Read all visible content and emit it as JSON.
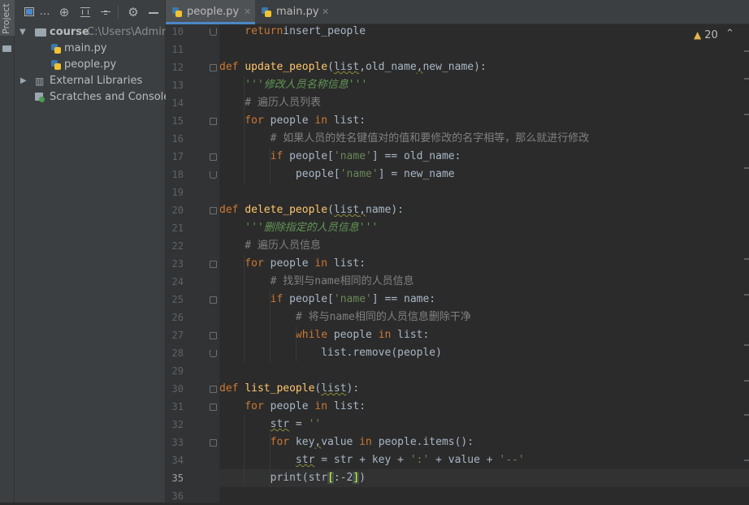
{
  "sidebar_strip": {
    "label": "Project"
  },
  "project_toolbar": {
    "icons": [
      "layout-icon",
      "ellipsis-icon",
      "locate-icon",
      "expand-all-icon",
      "collapse-all-icon",
      "gear-icon",
      "minimize-icon"
    ],
    "ellipsis": "…"
  },
  "project_tree": {
    "root": {
      "name": "course",
      "path": "C:\\Users\\Adminis"
    },
    "files": [
      {
        "name": "main.py"
      },
      {
        "name": "people.py"
      }
    ],
    "external_libraries": "External Libraries",
    "scratches": "Scratches and Consoles"
  },
  "editor_tabs": [
    {
      "name": "people.py",
      "active": true
    },
    {
      "name": "main.py",
      "active": false
    }
  ],
  "inspection": {
    "warning_count": "20",
    "icon": "warning-triangle-icon"
  },
  "colors": {
    "keyword": "#cc7832",
    "function": "#ffc66d",
    "string": "#6a8759",
    "comment": "#808080",
    "background": "#2b2b2b"
  },
  "code_lines": [
    {
      "ln": "10",
      "tokens": [
        [
          "kw",
          "    return"
        ],
        [
          "",
          "insert_people"
        ]
      ]
    },
    {
      "ln": "11",
      "tokens": []
    },
    {
      "ln": "12",
      "tokens": [
        [
          "kw",
          "def "
        ],
        [
          "fn",
          "update_people"
        ],
        [
          "",
          "("
        ],
        [
          "sq",
          "list"
        ],
        [
          "",
          ","
        ],
        [
          "",
          "old_name"
        ],
        [
          "sq",
          ","
        ],
        [
          "",
          "new_name):"
        ]
      ]
    },
    {
      "ln": "13",
      "tokens": [
        [
          "doc",
          "    '''修改人员名称信息'''"
        ]
      ]
    },
    {
      "ln": "14",
      "tokens": [
        [
          "cmt",
          "    # 遍历人员列表"
        ]
      ]
    },
    {
      "ln": "15",
      "tokens": [
        [
          "kw",
          "    for "
        ],
        [
          "",
          "people "
        ],
        [
          "kw",
          "in "
        ],
        [
          "",
          "list:"
        ]
      ]
    },
    {
      "ln": "16",
      "tokens": [
        [
          "cmt",
          "        # 如果人员的姓名键值对的值和要修改的名字相等，那么就进行修改"
        ]
      ]
    },
    {
      "ln": "17",
      "tokens": [
        [
          "kw",
          "        if "
        ],
        [
          "",
          "people["
        ],
        [
          "str",
          "'name'"
        ],
        [
          "",
          "] == old_name:"
        ]
      ]
    },
    {
      "ln": "18",
      "tokens": [
        [
          "",
          "            people["
        ],
        [
          "str",
          "'name'"
        ],
        [
          "",
          "] = new_name"
        ]
      ]
    },
    {
      "ln": "19",
      "tokens": []
    },
    {
      "ln": "20",
      "tokens": [
        [
          "kw",
          "def "
        ],
        [
          "fn",
          "delete_people"
        ],
        [
          "",
          "("
        ],
        [
          "sq",
          "list"
        ],
        [
          "sq",
          ","
        ],
        [
          "",
          "name):"
        ]
      ]
    },
    {
      "ln": "21",
      "tokens": [
        [
          "doc",
          "    '''删除指定的人员信息'''"
        ]
      ]
    },
    {
      "ln": "22",
      "tokens": [
        [
          "cmt",
          "    # 遍历人员信息"
        ]
      ]
    },
    {
      "ln": "23",
      "tokens": [
        [
          "kw",
          "    for "
        ],
        [
          "",
          "people "
        ],
        [
          "kw",
          "in "
        ],
        [
          "",
          "list:"
        ]
      ]
    },
    {
      "ln": "24",
      "tokens": [
        [
          "cmt",
          "        # 找到与name相同的人员信息"
        ]
      ]
    },
    {
      "ln": "25",
      "tokens": [
        [
          "kw",
          "        if "
        ],
        [
          "",
          "people["
        ],
        [
          "str",
          "'name'"
        ],
        [
          "",
          "] == name:"
        ]
      ]
    },
    {
      "ln": "26",
      "tokens": [
        [
          "cmt",
          "            # 将与name相同的人员信息删除干净"
        ]
      ]
    },
    {
      "ln": "27",
      "tokens": [
        [
          "kw",
          "            while "
        ],
        [
          "",
          "people "
        ],
        [
          "kw",
          "in "
        ],
        [
          "",
          "list:"
        ]
      ]
    },
    {
      "ln": "28",
      "tokens": [
        [
          "",
          "                list.remove(people)"
        ]
      ]
    },
    {
      "ln": "29",
      "tokens": []
    },
    {
      "ln": "30",
      "tokens": [
        [
          "kw",
          "def "
        ],
        [
          "fn",
          "list_people"
        ],
        [
          "",
          "("
        ],
        [
          "sq",
          "list"
        ],
        [
          "",
          "):"
        ]
      ]
    },
    {
      "ln": "31",
      "tokens": [
        [
          "kw",
          "    for "
        ],
        [
          "",
          "people "
        ],
        [
          "kw",
          "in "
        ],
        [
          "",
          "list:"
        ]
      ]
    },
    {
      "ln": "32",
      "tokens": [
        [
          "",
          "        "
        ],
        [
          "sq",
          "str"
        ],
        [
          "",
          " = "
        ],
        [
          "str",
          "''"
        ]
      ]
    },
    {
      "ln": "33",
      "tokens": [
        [
          "kw",
          "        for "
        ],
        [
          "",
          "key"
        ],
        [
          "sq",
          ","
        ],
        [
          "",
          "value "
        ],
        [
          "kw",
          "in "
        ],
        [
          "",
          "people.items():"
        ]
      ]
    },
    {
      "ln": "34",
      "tokens": [
        [
          "",
          "            "
        ],
        [
          "sq",
          "str"
        ],
        [
          "",
          " = str + key + "
        ],
        [
          "str",
          "':'"
        ],
        [
          "",
          " + value + "
        ],
        [
          "str",
          "'--'"
        ]
      ]
    },
    {
      "ln": "35",
      "tokens": [
        [
          "",
          "        print(str"
        ],
        [
          "br",
          "["
        ],
        [
          "",
          ":-2"
        ],
        [
          "br",
          "]"
        ],
        [
          "",
          ")"
        ]
      ]
    },
    {
      "ln": "36",
      "tokens": []
    }
  ]
}
